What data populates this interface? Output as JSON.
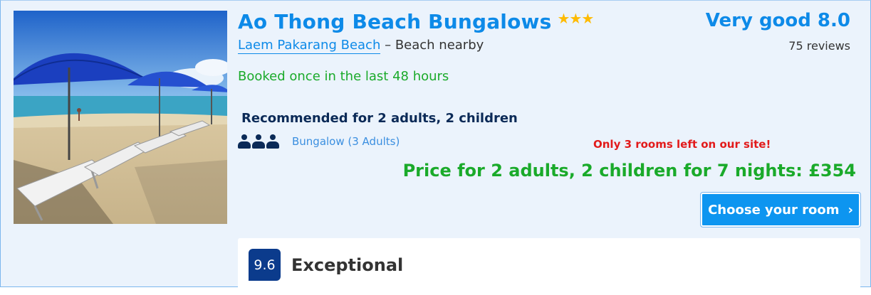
{
  "hotel": {
    "name": "Ao Thong Beach Bungalows",
    "stars": "★★★",
    "star_count": 3,
    "location_link": "Laem Pakarang Beach",
    "location_suffix": "– Beach nearby"
  },
  "rating": {
    "word_score": "Very good 8.0",
    "reviews": "75 reviews"
  },
  "booking": {
    "booked_note": "Booked once in the last 48 hours",
    "recommended": "Recommended for 2 adults, 2 children",
    "room_name": "Bungalow (3 Adults)",
    "occupancy_icon": "three-people-icon",
    "rooms_left": "Only 3 rooms left on our site!",
    "price": "Price for 2 adults, 2 children for 7 nights: £354",
    "choose_button": "Choose your room",
    "choose_chevron": "›"
  },
  "review_snippet": {
    "score": "9.6",
    "label": "Exceptional"
  },
  "colors": {
    "brand_blue": "#0d8ae8",
    "dark_navy": "#0b2a57",
    "green": "#1aaa2a",
    "red": "#e21b1b",
    "star_gold": "#febb02",
    "card_bg": "#ebf3fc"
  }
}
